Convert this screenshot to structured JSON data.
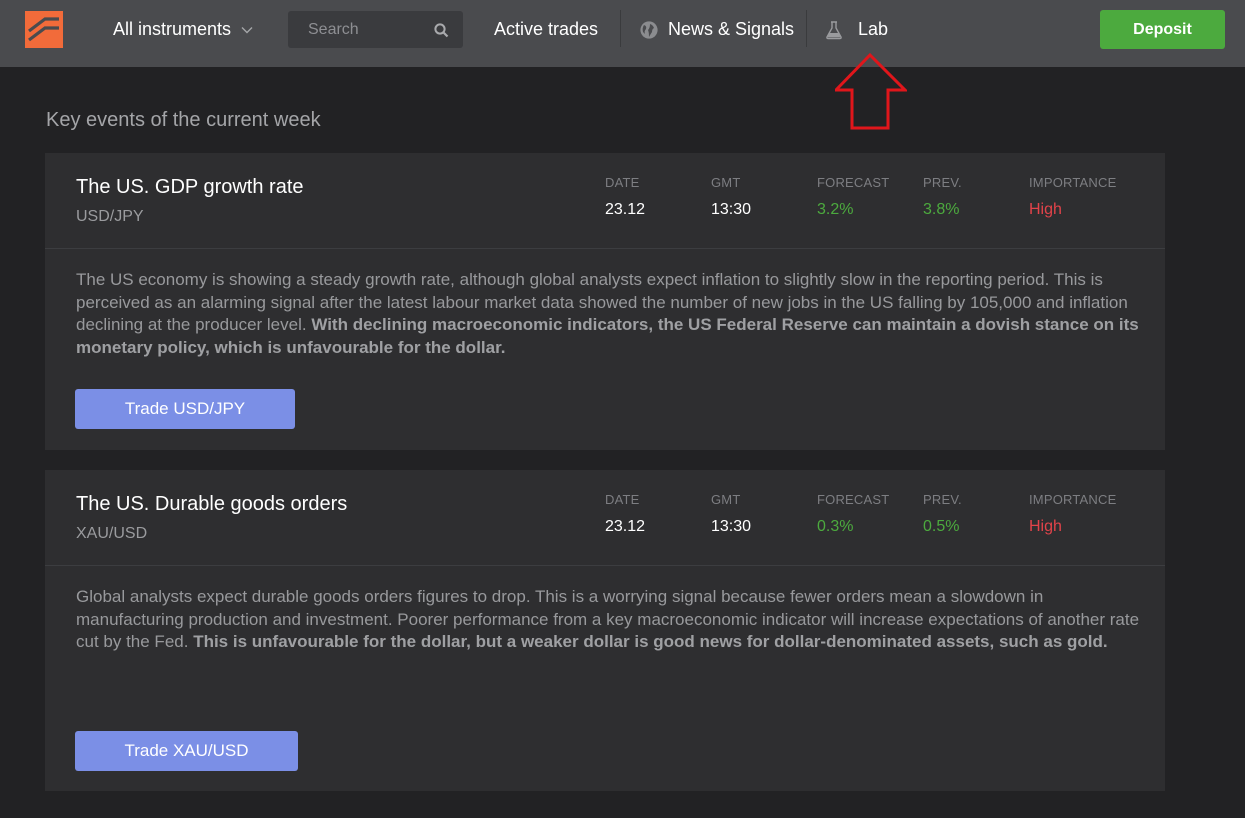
{
  "header": {
    "instruments_label": "All instruments",
    "search_placeholder": "Search",
    "nav": {
      "active_trades": "Active trades",
      "news_signals": "News & Signals",
      "lab": "Lab"
    },
    "deposit_label": "Deposit",
    "colors": {
      "bar": "#4a4b4e",
      "logo": "#f26b3a",
      "deposit": "#4caa3e"
    }
  },
  "section_title": "Key events of the current week",
  "stat_labels": {
    "date": "DATE",
    "gmt": "GMT",
    "forecast": "FORECAST",
    "prev": "PREV.",
    "importance": "IMPORTANCE"
  },
  "events": [
    {
      "title": "The US. GDP growth rate",
      "pair": "USD/JPY",
      "date": "23.12",
      "gmt": "13:30",
      "forecast": "3.2%",
      "prev": "3.8%",
      "importance": "High",
      "text": "The US economy is showing a steady growth rate, although global analysts expect inflation to slightly slow in the reporting period. This is perceived as an alarming signal after the latest labour market data showed the number of new jobs in the US falling by 105,000 and inflation declining at the producer level. ",
      "text_bold": "With declining macroeconomic indicators, the US Federal Reserve can maintain a dovish stance on its monetary policy, which is unfavourable for the dollar.",
      "button": "Trade USD/JPY"
    },
    {
      "title": "The US. Durable goods orders",
      "pair": "XAU/USD",
      "date": "23.12",
      "gmt": "13:30",
      "forecast": "0.3%",
      "prev": "0.5%",
      "importance": "High",
      "text": "Global analysts expect durable goods orders figures to drop. This is a worrying signal because fewer orders mean a slowdown in manufacturing production and investment. Poorer performance from a key macroeconomic indicator will increase expectations of another rate cut by the Fed. ",
      "text_bold": "This is unfavourable for the dollar, but a weaker dollar is good news for dollar-denominated assets, such as gold.",
      "button": "Trade XAU/USD"
    }
  ],
  "icons": [
    "logo-icon",
    "chevron-down-icon",
    "search-icon",
    "globe-icon",
    "flask-icon",
    "arrow-up-annotation"
  ],
  "colors": {
    "positive": "#4caa3e",
    "importance_high": "#e2434a",
    "trade_button": "#7b8fe6",
    "annotation": "#e0161b"
  }
}
